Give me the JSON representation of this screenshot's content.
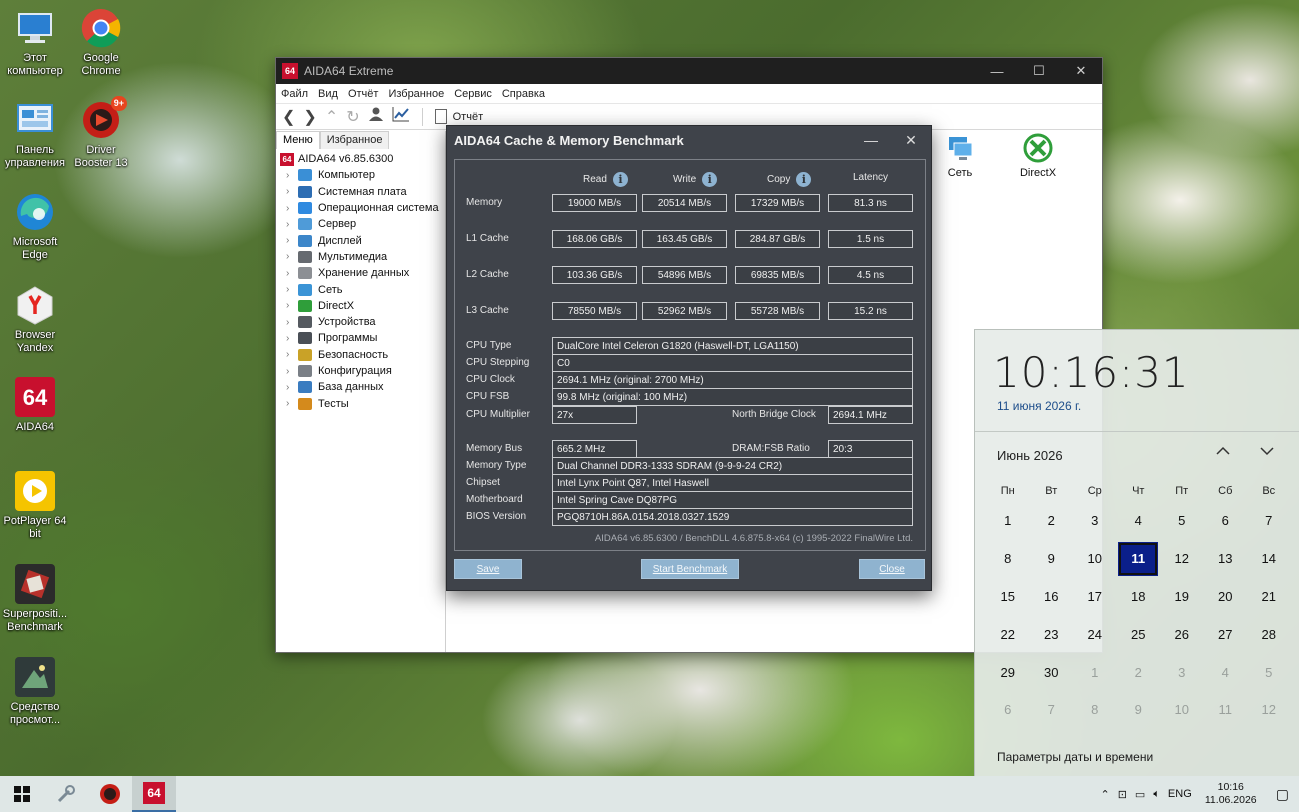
{
  "desktop": {
    "icons": [
      {
        "label": "Этот\nкомпьютер",
        "icon": "computer-icon"
      },
      {
        "label": "Google\nChrome",
        "icon": "chrome-icon"
      },
      {
        "label": "Панель\nуправления",
        "icon": "control-panel-icon"
      },
      {
        "label": "Driver\nBooster 13",
        "icon": "driver-booster-icon",
        "badge": "9+"
      },
      {
        "label": "Microsoft\nEdge",
        "icon": "edge-icon"
      },
      {
        "label": "Browser\nYandex",
        "icon": "yandex-icon"
      },
      {
        "label": "AIDA64",
        "icon": "aida64-icon"
      },
      {
        "label": "PotPlayer 64\nbit",
        "icon": "potplayer-icon"
      },
      {
        "label": "Superpositi...\nBenchmark",
        "icon": "superposition-icon"
      },
      {
        "label": "Средство\nпросмот...",
        "icon": "viewer-icon"
      }
    ]
  },
  "aida": {
    "app_icon_text": "64",
    "title": "AIDA64 Extreme",
    "menu": [
      "Файл",
      "Вид",
      "Отчёт",
      "Избранное",
      "Сервис",
      "Справка"
    ],
    "report_label": "Отчёт",
    "tabs": {
      "menu": "Меню",
      "favorites": "Избранное"
    },
    "tree_root": "AIDA64 v6.85.6300",
    "tree": [
      {
        "label": "Компьютер",
        "color": "#3a8fd6"
      },
      {
        "label": "Системная плата",
        "color": "#2d6db3"
      },
      {
        "label": "Операционная система",
        "color": "#2f8ae0"
      },
      {
        "label": "Сервер",
        "color": "#4f9bd8"
      },
      {
        "label": "Дисплей",
        "color": "#3c86c9"
      },
      {
        "label": "Мультимедиа",
        "color": "#666a70"
      },
      {
        "label": "Хранение данных",
        "color": "#8c8f94"
      },
      {
        "label": "Сеть",
        "color": "#3b94d6"
      },
      {
        "label": "DirectX",
        "color": "#2f9e3a"
      },
      {
        "label": "Устройства",
        "color": "#555a60"
      },
      {
        "label": "Программы",
        "color": "#4a4f56"
      },
      {
        "label": "Безопасность",
        "color": "#c9a227"
      },
      {
        "label": "Конфигурация",
        "color": "#7a7f86"
      },
      {
        "label": "База данных",
        "color": "#3a7cc0"
      },
      {
        "label": "Тесты",
        "color": "#d48a1c"
      }
    ],
    "right_icons": [
      {
        "label": "Сеть",
        "icon": "network-icon"
      },
      {
        "label": "DirectX",
        "icon": "directx-icon"
      }
    ]
  },
  "bench": {
    "title": "AIDA64 Cache & Memory Benchmark",
    "headers": {
      "read": "Read",
      "write": "Write",
      "copy": "Copy",
      "latency": "Latency"
    },
    "rows": [
      {
        "label": "Memory",
        "read": "19000 MB/s",
        "write": "20514 MB/s",
        "copy": "17329 MB/s",
        "latency": "81.3 ns"
      },
      {
        "label": "L1 Cache",
        "read": "168.06 GB/s",
        "write": "163.45 GB/s",
        "copy": "284.87 GB/s",
        "latency": "1.5 ns"
      },
      {
        "label": "L2 Cache",
        "read": "103.36 GB/s",
        "write": "54896 MB/s",
        "copy": "69835 MB/s",
        "latency": "4.5 ns"
      },
      {
        "label": "L3 Cache",
        "read": "78550 MB/s",
        "write": "52962 MB/s",
        "copy": "55728 MB/s",
        "latency": "15.2 ns"
      }
    ],
    "cpu": {
      "type_label": "CPU Type",
      "type": "DualCore Intel Celeron G1820  (Haswell-DT, LGA1150)",
      "stepping_label": "CPU Stepping",
      "stepping": "C0",
      "clock_label": "CPU Clock",
      "clock": "2694.1 MHz  (original: 2700 MHz)",
      "fsb_label": "CPU FSB",
      "fsb": "99.8 MHz  (original: 100 MHz)",
      "mult_label": "CPU Multiplier",
      "mult": "27x",
      "nb_label": "North Bridge Clock",
      "nb": "2694.1 MHz"
    },
    "mem": {
      "bus_label": "Memory Bus",
      "bus": "665.2 MHz",
      "ratio_label": "DRAM:FSB Ratio",
      "ratio": "20:3",
      "type_label": "Memory Type",
      "type": "Dual Channel DDR3-1333 SDRAM  (9-9-9-24 CR2)",
      "chipset_label": "Chipset",
      "chipset": "Intel Lynx Point Q87, Intel Haswell",
      "mb_label": "Motherboard",
      "mb": "Intel Spring Cave DQ87PG",
      "bios_label": "BIOS Version",
      "bios": "PGQ8710H.86A.0154.2018.0327.1529"
    },
    "footer": "AIDA64 v6.85.6300 / BenchDLL 4.6.875.8-x64  (c) 1995-2022 FinalWire Ltd.",
    "buttons": {
      "save": "Save",
      "start": "Start Benchmark",
      "close": "Close"
    }
  },
  "calendar": {
    "time": "10:16:31",
    "date": "11 июня 2026 г.",
    "month": "Июнь 2026",
    "weekdays": [
      "Пн",
      "Вт",
      "Ср",
      "Чт",
      "Пт",
      "Сб",
      "Вс"
    ],
    "days": [
      "1",
      "2",
      "3",
      "4",
      "5",
      "6",
      "7",
      "8",
      "9",
      "10",
      "11",
      "12",
      "13",
      "14",
      "15",
      "16",
      "17",
      "18",
      "19",
      "20",
      "21",
      "22",
      "23",
      "24",
      "25",
      "26",
      "27",
      "28",
      "29",
      "30",
      "1",
      "2",
      "3",
      "4",
      "5",
      "6",
      "7",
      "8",
      "9",
      "10",
      "11",
      "12"
    ],
    "muted_from": 30,
    "today_index": 10,
    "settings": "Параметры даты и времени"
  },
  "taskbar": {
    "lang": "ENG",
    "time": "10:16",
    "date": "11.06.2026"
  }
}
